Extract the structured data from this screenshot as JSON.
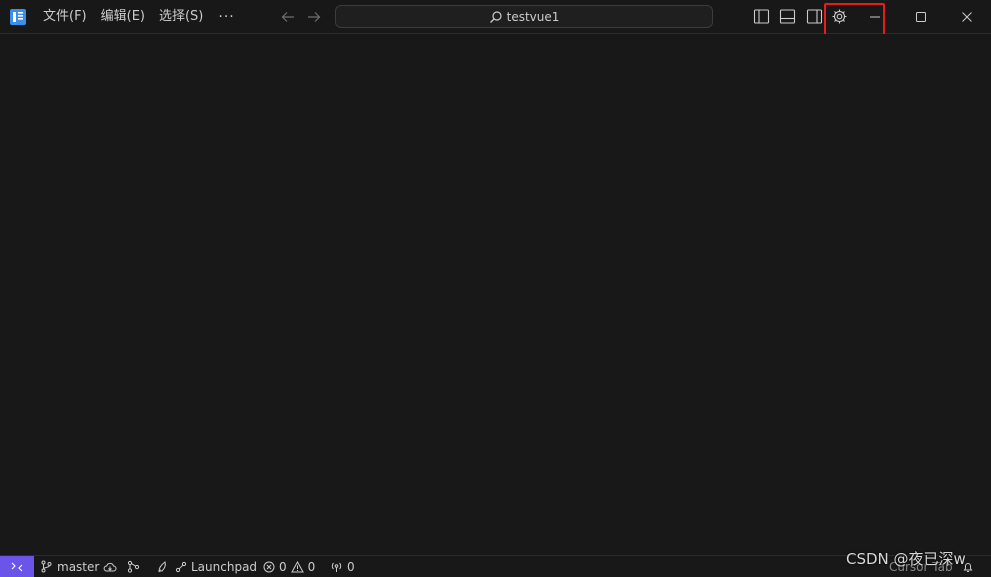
{
  "titlebar": {
    "menu": [
      {
        "label": "文件(F)"
      },
      {
        "label": "编辑(E)"
      },
      {
        "label": "选择(S)"
      }
    ],
    "more_label": "···",
    "search": {
      "text": "testvue1"
    }
  },
  "layout_icons": [
    "toggle-primary-sidebar-icon",
    "toggle-panel-icon",
    "toggle-secondary-sidebar-icon",
    "gear-icon"
  ],
  "window_controls": [
    "minimize-icon",
    "maximize-icon",
    "close-icon"
  ],
  "statusbar": {
    "branch": "master",
    "launchpad": "Launchpad",
    "errors": "0",
    "warnings": "0",
    "ports": "0",
    "cursor_tab": "Cursor Tab"
  },
  "watermark": "CSDN @夜已深w",
  "colors": {
    "background": "#181818",
    "remote_accent": "#6a55e8",
    "highlight": "#e81c1c",
    "logo": "#3b8eea"
  }
}
